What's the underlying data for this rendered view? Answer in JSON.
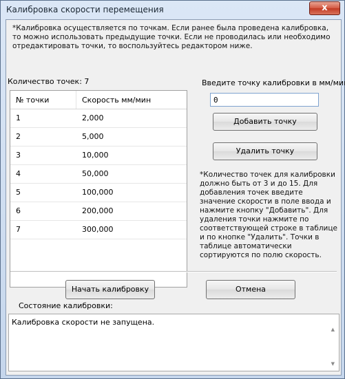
{
  "window": {
    "title": "Калибровка скорости перемещения",
    "close_label": "x"
  },
  "notes": {
    "top": "*Калибровка осуществляется по точкам. Если ранее была проведена калибровка, то можно использовать предыдущие точки. Если не проводилась или необходимо отредактировать точки, то воспользуйтесь редактором ниже.",
    "right": "*Количество точек для калибровки должно быть от 3 и до 15. Для добавления точек введите значение скорости в поле ввода и нажмите кнопку \"Добавить\". Для удаления точки нажмите по соответствующей строке в таблице и по  кнопке \"Удалить\". Точки в таблице автоматически сортируются по полю скорость."
  },
  "count_label": "Количество точек: 7",
  "enter_label": "Введите точку калибровки в мм/мин",
  "input_value": "0",
  "table": {
    "headers": [
      "№ точки",
      "Скорость мм/мин"
    ],
    "rows": [
      [
        "1",
        "2,000"
      ],
      [
        "2",
        "5,000"
      ],
      [
        "3",
        "10,000"
      ],
      [
        "4",
        "50,000"
      ],
      [
        "5",
        "100,000"
      ],
      [
        "6",
        "200,000"
      ],
      [
        "7",
        "300,000"
      ]
    ]
  },
  "buttons": {
    "add": "Добавить точку",
    "delete": "Удалить точку",
    "start": "Начать калибровку",
    "cancel": "Отмена"
  },
  "status": {
    "label": "Состояние калибровки:",
    "text": "Калибровка скорости не запущена."
  },
  "colors": {
    "accent": "#7ea2cf",
    "close": "#c23b24"
  }
}
